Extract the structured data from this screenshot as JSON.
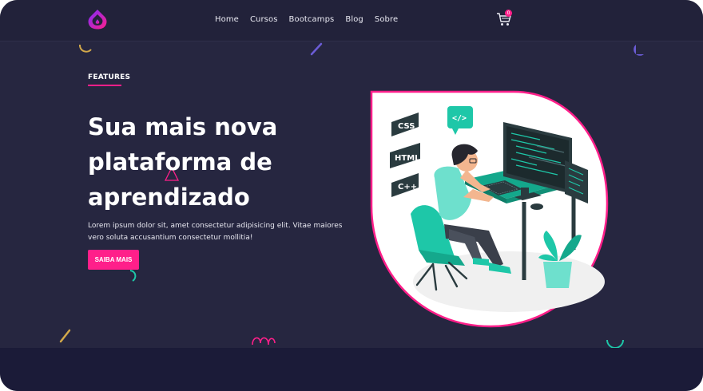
{
  "header": {
    "nav": [
      "Home",
      "Cursos",
      "Bootcamps",
      "Blog",
      "Sobre"
    ],
    "cart_badge": "0"
  },
  "hero": {
    "eyebrow": "FEATURES",
    "title": "Sua mais nova plataforma de aprendizado",
    "description": "Lorem ipsum dolor sit, amet consectetur adipisicing elit. Vitae maiores vero soluta accusantium consectetur mollitia!",
    "cta": "SAIBA MAIS"
  },
  "illustration": {
    "tags": [
      "CSS",
      "HTML",
      "C++"
    ],
    "code_tag": "</>"
  },
  "colors": {
    "background": "#262640",
    "header": "#22223a",
    "accent": "#ff1f8a",
    "teal": "#1ec7a8",
    "bottom_band": "#1b1b38"
  },
  "icons": [
    "logo-icon",
    "cart-icon"
  ]
}
